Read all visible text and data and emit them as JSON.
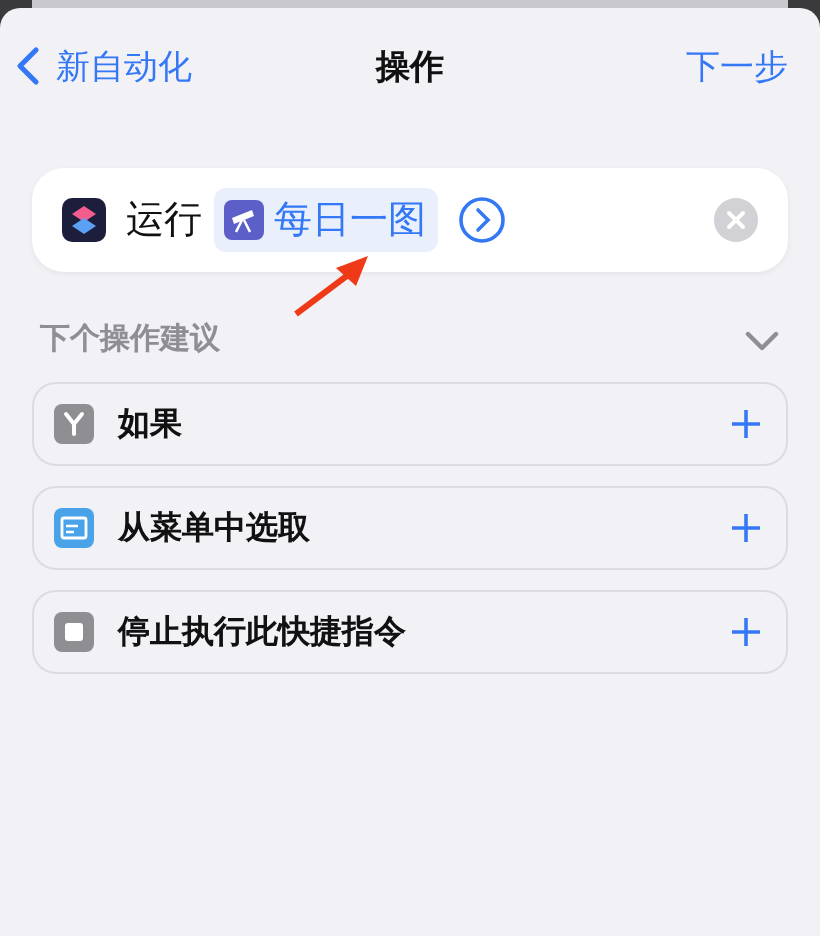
{
  "nav": {
    "back": "新自动化",
    "title": "操作",
    "next": "下一步"
  },
  "action": {
    "verb": "运行",
    "shortcut": "每日一图"
  },
  "suggestions": {
    "title": "下个操作建议",
    "expanded": true,
    "items": [
      {
        "kind": "if",
        "label": "如果"
      },
      {
        "kind": "menu",
        "label": "从菜单中选取"
      },
      {
        "kind": "stop",
        "label": "停止执行此快捷指令"
      }
    ]
  }
}
